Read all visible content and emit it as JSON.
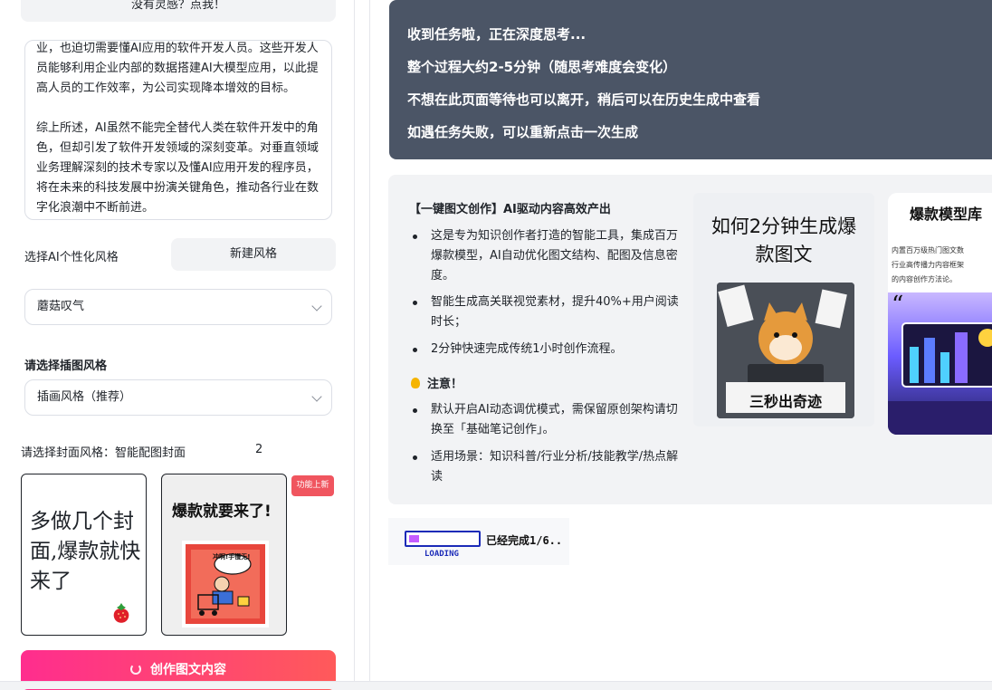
{
  "left": {
    "inspire_button": "没有灵感？点我！",
    "article_paragraphs": [
      "业，也迫切需要懂AI应用的软件开发人员。这些开发人员能够利用企业内部的数据搭建AI大模型应用，以此提高人员的工作效率，为公司实现降本增效的目标。",
      "综上所述，AI虽然不能完全替代人类在软件开发中的角色，但却引发了软件开发领域的深刻变革。对垂直领域业务理解深刻的技术专家以及懂AI应用开发的程序员，将在未来的科技发展中扮演关键角色，推动各行业在数字化浪潮中不断前进。"
    ],
    "ai_style_label": "选择AI个性化风格",
    "new_style_button": "新建风格",
    "ai_style_value": "蘑菇叹气",
    "illustration_label": "请选择插图风格",
    "illustration_value": "插画风格（推荐）",
    "cover_label": "请选择封面风格：智能配图封面",
    "cover_count": "2",
    "cover1_text": "多做几个封面,爆款就快来了",
    "cover2_title": "爆款就要来了!",
    "cover2_art_text": "冲啊!手慢无!",
    "new_badge": "功能上新",
    "create_button": "创作图文内容"
  },
  "status": {
    "lines": [
      "收到任务啦，正在深度思考...",
      "整个过程大约2-5分钟（随思考难度会变化）",
      "不想在此页面等待也可以离开，稍后可以在历史生成中查看",
      "如遇任务失败，可以重新点击一次生成"
    ]
  },
  "info": {
    "heading": "【一键图文创作】AI驱动内容高效产出",
    "bullets": [
      "这是专为知识创作者打造的智能工具，集成百万爆款模型，AI自动优化图文结构、配图及信息密度。",
      "智能生成高关联视觉素材，提升40%+用户阅读时长；",
      "2分钟快速完成传统1小时创作流程。"
    ],
    "note_title": "注意！",
    "note_bullets": [
      "默认开启AI动态调优模式，需保留原创架构请切换至「基础笔记创作」。",
      "适用场景：知识科普/行业分析/技能教学/热点解读"
    ],
    "thumb1_title": "如何2分钟生成爆款图文",
    "thumb1_caption": "三秒出奇迹",
    "thumb2_title": "爆款模型库",
    "thumb2_sub": [
      "内置百万级热门图文数",
      "行业高传播力内容框架",
      "的内容创作方法论。"
    ]
  },
  "loading": {
    "label": "LOADING",
    "done_text": "已经完成1/6..",
    "progress": 0.15
  },
  "colors": {
    "dark_card": "#4b5566",
    "create_gradient_start": "#ff2d8e",
    "create_gradient_end": "#ff5a5a",
    "badge": "#f0555f"
  }
}
